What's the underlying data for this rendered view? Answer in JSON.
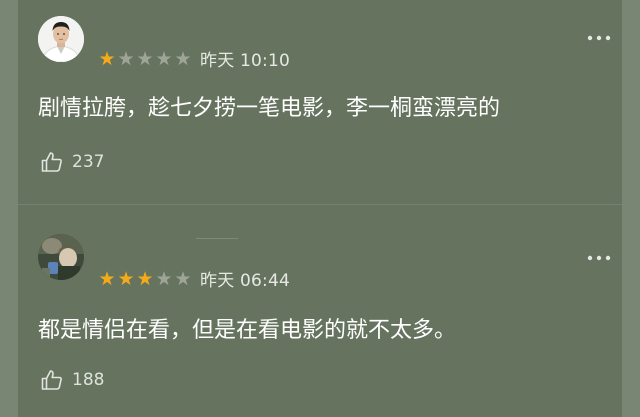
{
  "comments": [
    {
      "rating": 1,
      "max_rating": 5,
      "time": "昨天 10:10",
      "text": "剧情拉胯，趁七夕捞一笔电影，李一桐蛮漂亮的",
      "likes": "237",
      "avatar_icon": "user-avatar-icon"
    },
    {
      "rating": 3,
      "max_rating": 5,
      "time": "昨天 06:44",
      "text": "都是情侣在看，但是在看电影的就不太多。",
      "likes": "188",
      "avatar_icon": "user-avatar-icon"
    }
  ],
  "colors": {
    "background": "#66735f",
    "star_on": "#f4ab1a",
    "star_off": "#9ea597",
    "text": "#ffffff"
  }
}
